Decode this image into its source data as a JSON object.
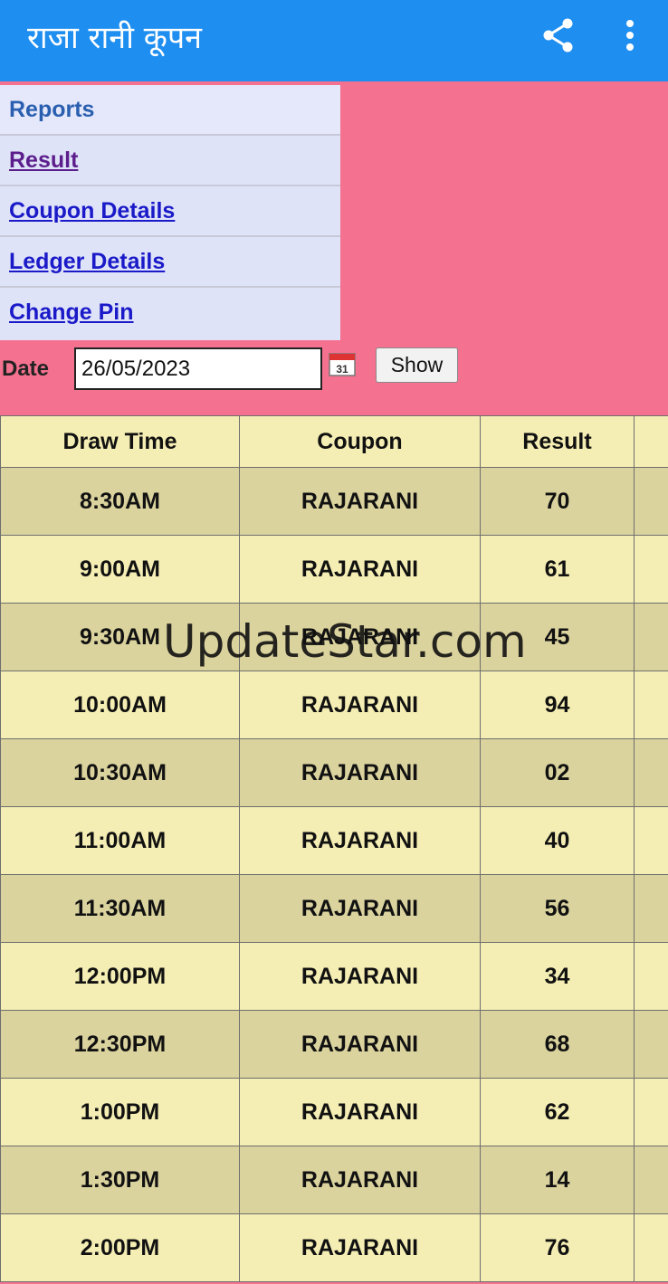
{
  "app_bar": {
    "title": "राजा रानी कूपन",
    "share_icon": "share-icon",
    "more_icon": "more-vert-icon"
  },
  "menu": {
    "header": "Reports",
    "items": [
      {
        "label": "Result"
      },
      {
        "label": "Coupon Details"
      },
      {
        "label": "Ledger Details"
      },
      {
        "label": "Change Pin"
      }
    ]
  },
  "date_filter": {
    "label": "Date",
    "value": "26/05/2023",
    "calendar_icon": "calendar-icon",
    "calendar_day": "31",
    "show_label": "Show"
  },
  "table": {
    "columns": [
      "Draw Time",
      "Coupon",
      "Result",
      ""
    ],
    "rows": [
      {
        "time": "8:30AM",
        "coupon": "RAJARANI",
        "result": "70"
      },
      {
        "time": "9:00AM",
        "coupon": "RAJARANI",
        "result": "61"
      },
      {
        "time": "9:30AM",
        "coupon": "RAJARANI",
        "result": "45"
      },
      {
        "time": "10:00AM",
        "coupon": "RAJARANI",
        "result": "94"
      },
      {
        "time": "10:30AM",
        "coupon": "RAJARANI",
        "result": "02"
      },
      {
        "time": "11:00AM",
        "coupon": "RAJARANI",
        "result": "40"
      },
      {
        "time": "11:30AM",
        "coupon": "RAJARANI",
        "result": "56"
      },
      {
        "time": "12:00PM",
        "coupon": "RAJARANI",
        "result": "34"
      },
      {
        "time": "12:30PM",
        "coupon": "RAJARANI",
        "result": "68"
      },
      {
        "time": "1:00PM",
        "coupon": "RAJARANI",
        "result": "62"
      },
      {
        "time": "1:30PM",
        "coupon": "RAJARANI",
        "result": "14"
      },
      {
        "time": "2:00PM",
        "coupon": "RAJARANI",
        "result": "76"
      }
    ]
  },
  "watermark": "UpdateStar.com",
  "colors": {
    "app_bar": "#1e8ef0",
    "background": "#f4718f",
    "menu_bg": "#dfe3f8",
    "row_light": "#f5eeb4",
    "row_dark": "#dbd39e"
  }
}
